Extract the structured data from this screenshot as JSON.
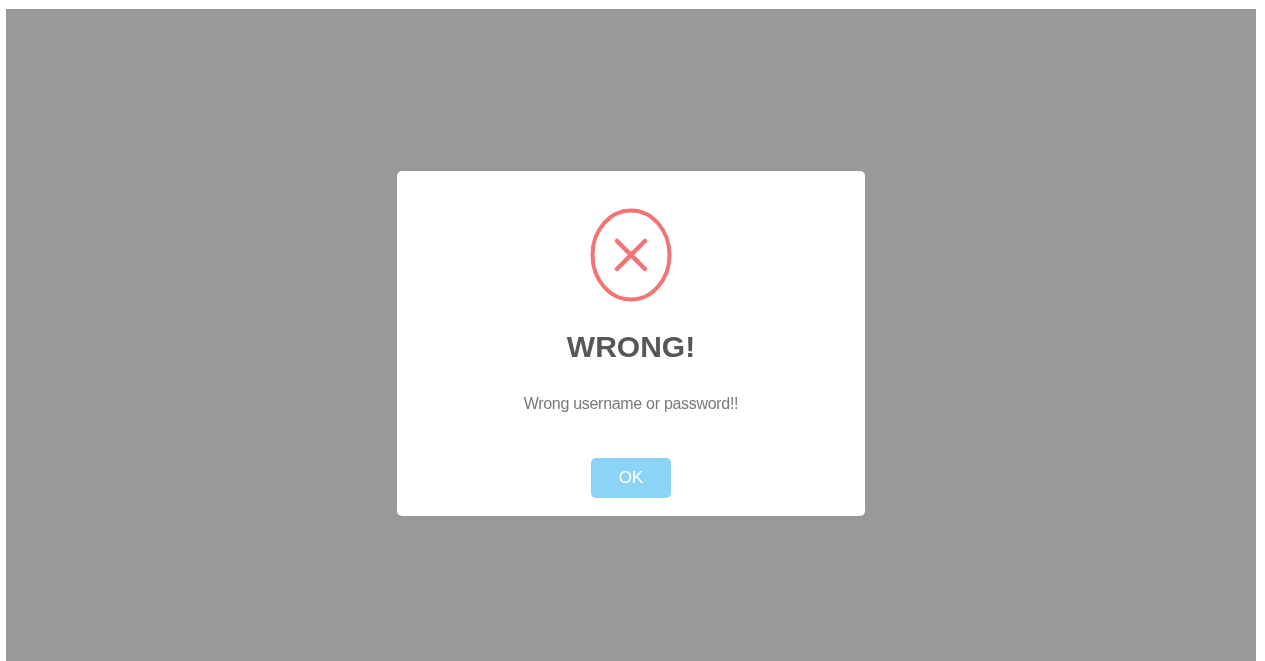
{
  "dialog": {
    "kind": "error",
    "title": "WRONG!",
    "message": "Wrong username or password!!",
    "buttons": [
      "OK"
    ]
  }
}
